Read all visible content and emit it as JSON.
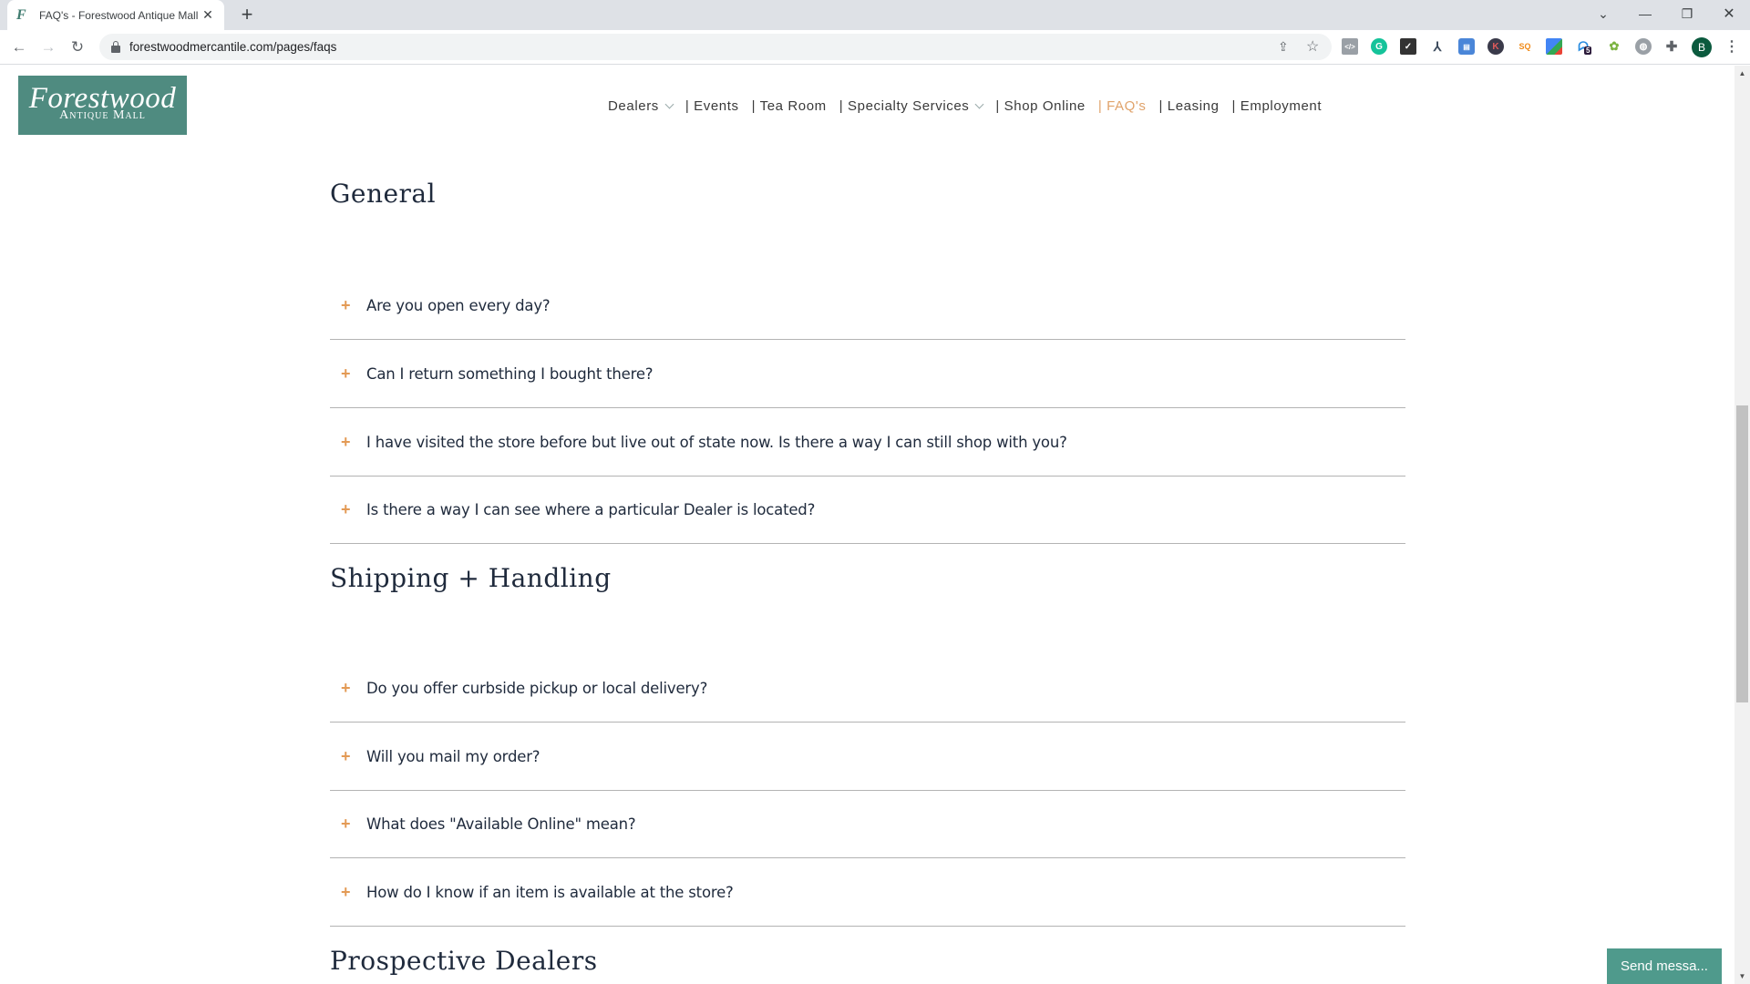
{
  "browser": {
    "tab_title": "FAQ's - Forestwood Antique Mall",
    "favicon": "F",
    "url": "forestwoodmercantile.com/pages/faqs",
    "profile_initial": "B",
    "extension_badge": "5",
    "extensions": [
      "code-view-extension",
      "grammarly-extension",
      "checkmark-extension",
      "fork-extension",
      "tag-extension",
      "k-extension",
      "sq-extension",
      "google-extension",
      "ghost-extension",
      "frog-extension",
      "globe-extension",
      "extensions-puzzle"
    ]
  },
  "site": {
    "logo_line1": "Forestwood",
    "logo_line2": "Antique Mall",
    "nav": [
      {
        "label": "Dealers",
        "dropdown": true,
        "active": false
      },
      {
        "label": "| Events",
        "dropdown": false,
        "active": false
      },
      {
        "label": "| Tea Room",
        "dropdown": false,
        "active": false
      },
      {
        "label": "| Specialty Services",
        "dropdown": true,
        "active": false
      },
      {
        "label": "| Shop Online",
        "dropdown": false,
        "active": false
      },
      {
        "label": "| FAQ's",
        "dropdown": false,
        "active": true
      },
      {
        "label": "| Leasing",
        "dropdown": false,
        "active": false
      },
      {
        "label": "| Employment",
        "dropdown": false,
        "active": false
      }
    ],
    "accent_color": "#e39a55",
    "brand_color": "#4f8b80"
  },
  "sections": [
    {
      "title": "General",
      "questions": [
        "Are you open every day?",
        "Can I return something I bought there?",
        "I have visited the store before but live out of state now. Is there a way I can still shop with you?",
        "Is there a way I can see where a particular Dealer is located?"
      ]
    },
    {
      "title": "Shipping + Handling",
      "questions": [
        "Do you offer curbside pickup or local delivery?",
        "Will you mail my order?",
        "What does \"Available Online\" mean?",
        "How do I know if an item is available at the store?"
      ]
    },
    {
      "title": "Prospective Dealers",
      "questions": []
    }
  ],
  "chat": {
    "label": "Send messa..."
  },
  "icons": {
    "plus": "+",
    "back": "←",
    "forward": "→",
    "reload": "↻",
    "close": "✕",
    "new_tab": "+",
    "minimize": "—",
    "restore": "❐",
    "tab_list": "⌄",
    "share": "⇪",
    "star": "☆",
    "menu": "⋮",
    "scroll_up": "▲",
    "scroll_down": "▼"
  }
}
